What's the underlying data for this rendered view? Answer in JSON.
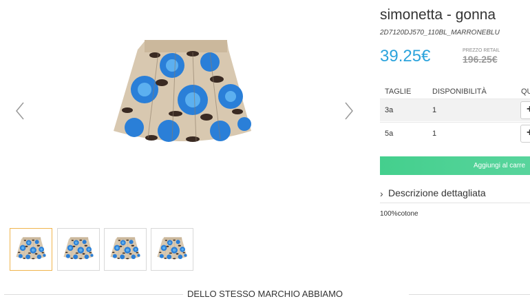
{
  "product": {
    "title": "simonetta - gonna",
    "sku": "2D7120DJ570_110BL_MARRONEBLU",
    "price": "39.25€",
    "retail_label": "PREZZO RETAIL",
    "retail_price": "196.25€",
    "price_color": "#2ba3dc"
  },
  "sizes_table": {
    "headers": [
      "TAGLIE",
      "DISPONIBILITÀ",
      "QU"
    ],
    "rows": [
      {
        "size": "3a",
        "availability": "1",
        "qty_control": "+"
      },
      {
        "size": "5a",
        "availability": "1",
        "qty_control": "+"
      }
    ]
  },
  "add_to_cart": {
    "label": "Aggiungi al carre",
    "color": "#44cf8d"
  },
  "description": {
    "heading": "Descrizione dettagliata",
    "text": "100%cotone"
  },
  "gallery": {
    "prev_icon": "chevron-left-icon",
    "next_icon": "chevron-right-icon",
    "thumbnail_count": 4,
    "active_thumbnail": 1
  },
  "brand_section": {
    "title": "DELLO STESSO MARCHIO ABBIAMO"
  }
}
